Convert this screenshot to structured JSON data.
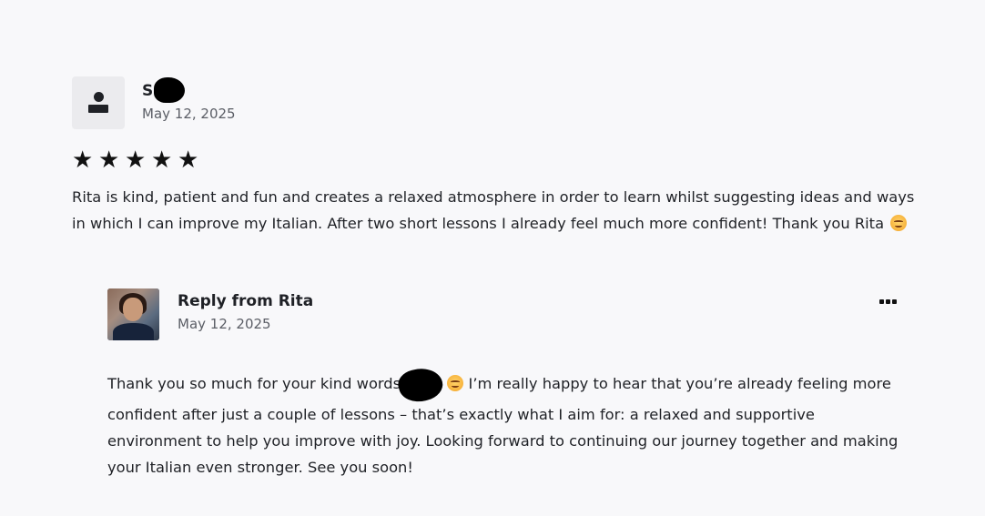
{
  "review": {
    "reviewer_name": "S",
    "date": "May 12, 2025",
    "rating": 5,
    "stars": [
      "★",
      "★",
      "★",
      "★",
      "★"
    ],
    "text": "Rita is kind, patient and fun and creates a relaxed atmosphere in order to learn whilst suggesting ideas and ways in which I can improve my Italian. After two short lessons I already feel much more confident! Thank you Rita"
  },
  "reply": {
    "title": "Reply from Rita",
    "date": "May 12, 2025",
    "text_before": "Thank you so much for your kind words",
    "text_after": "I’m really happy to hear that you’re already feeling more confident after just a couple of lessons – that’s exactly what I aim for: a relaxed and supportive environment to help you improve with joy. Looking forward to continuing our journey together and making your Italian even stronger. See you soon!"
  },
  "icons": {
    "default_avatar": "user-silhouette-icon",
    "more": "more-options-icon",
    "emoji": "smiling-face-emoji-icon",
    "star": "star-icon"
  }
}
